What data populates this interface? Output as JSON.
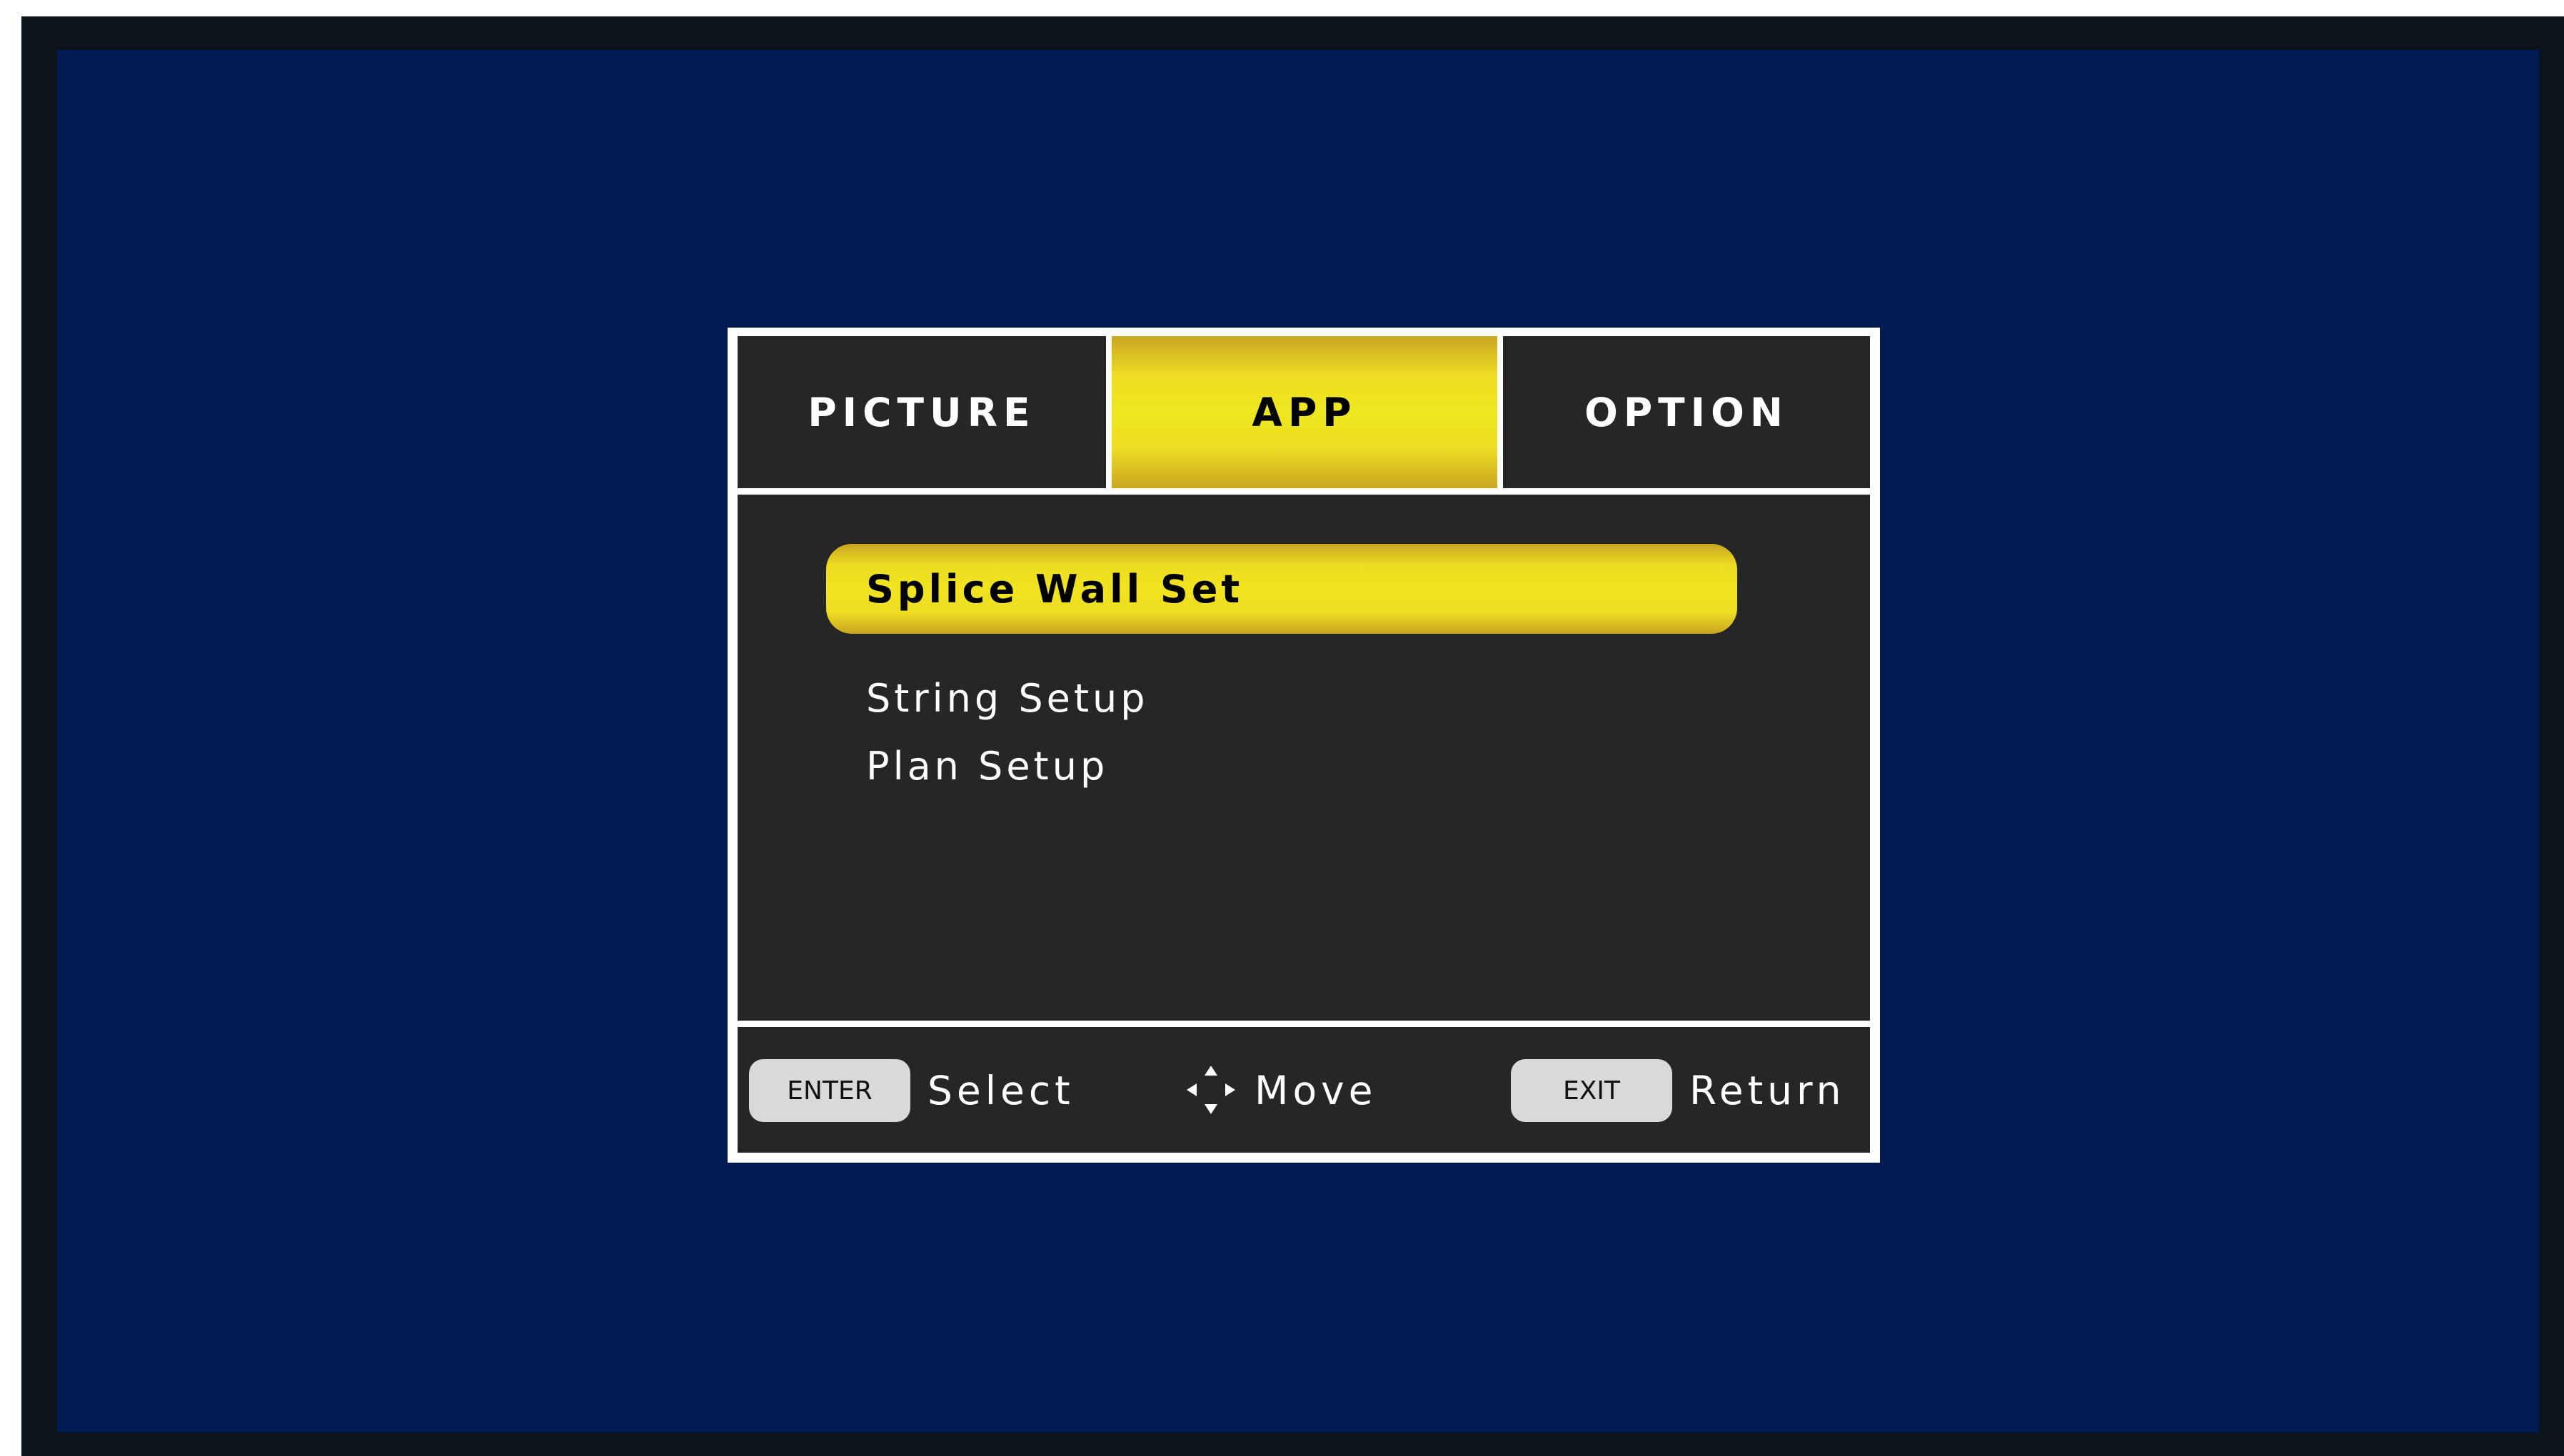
{
  "tabs": [
    {
      "label": "PICTURE",
      "active": false
    },
    {
      "label": "APP",
      "active": true
    },
    {
      "label": "OPTION",
      "active": false
    }
  ],
  "menu": {
    "items": [
      {
        "label": "Splice Wall Set",
        "selected": true
      },
      {
        "label": "String Setup",
        "selected": false
      },
      {
        "label": "Plan Setup",
        "selected": false
      }
    ]
  },
  "footer": {
    "enter_key": "ENTER",
    "select_label": "Select",
    "move_icon": "four-way-arrows-icon",
    "move_label": "Move",
    "exit_key": "EXIT",
    "return_label": "Return"
  },
  "colors": {
    "screen_background": "#001b52",
    "bezel": "#0b131c",
    "panel": "#262626",
    "highlight_yellow": "#eee71e",
    "highlight_gold": "#c9a622",
    "frame": "#ffffff"
  }
}
